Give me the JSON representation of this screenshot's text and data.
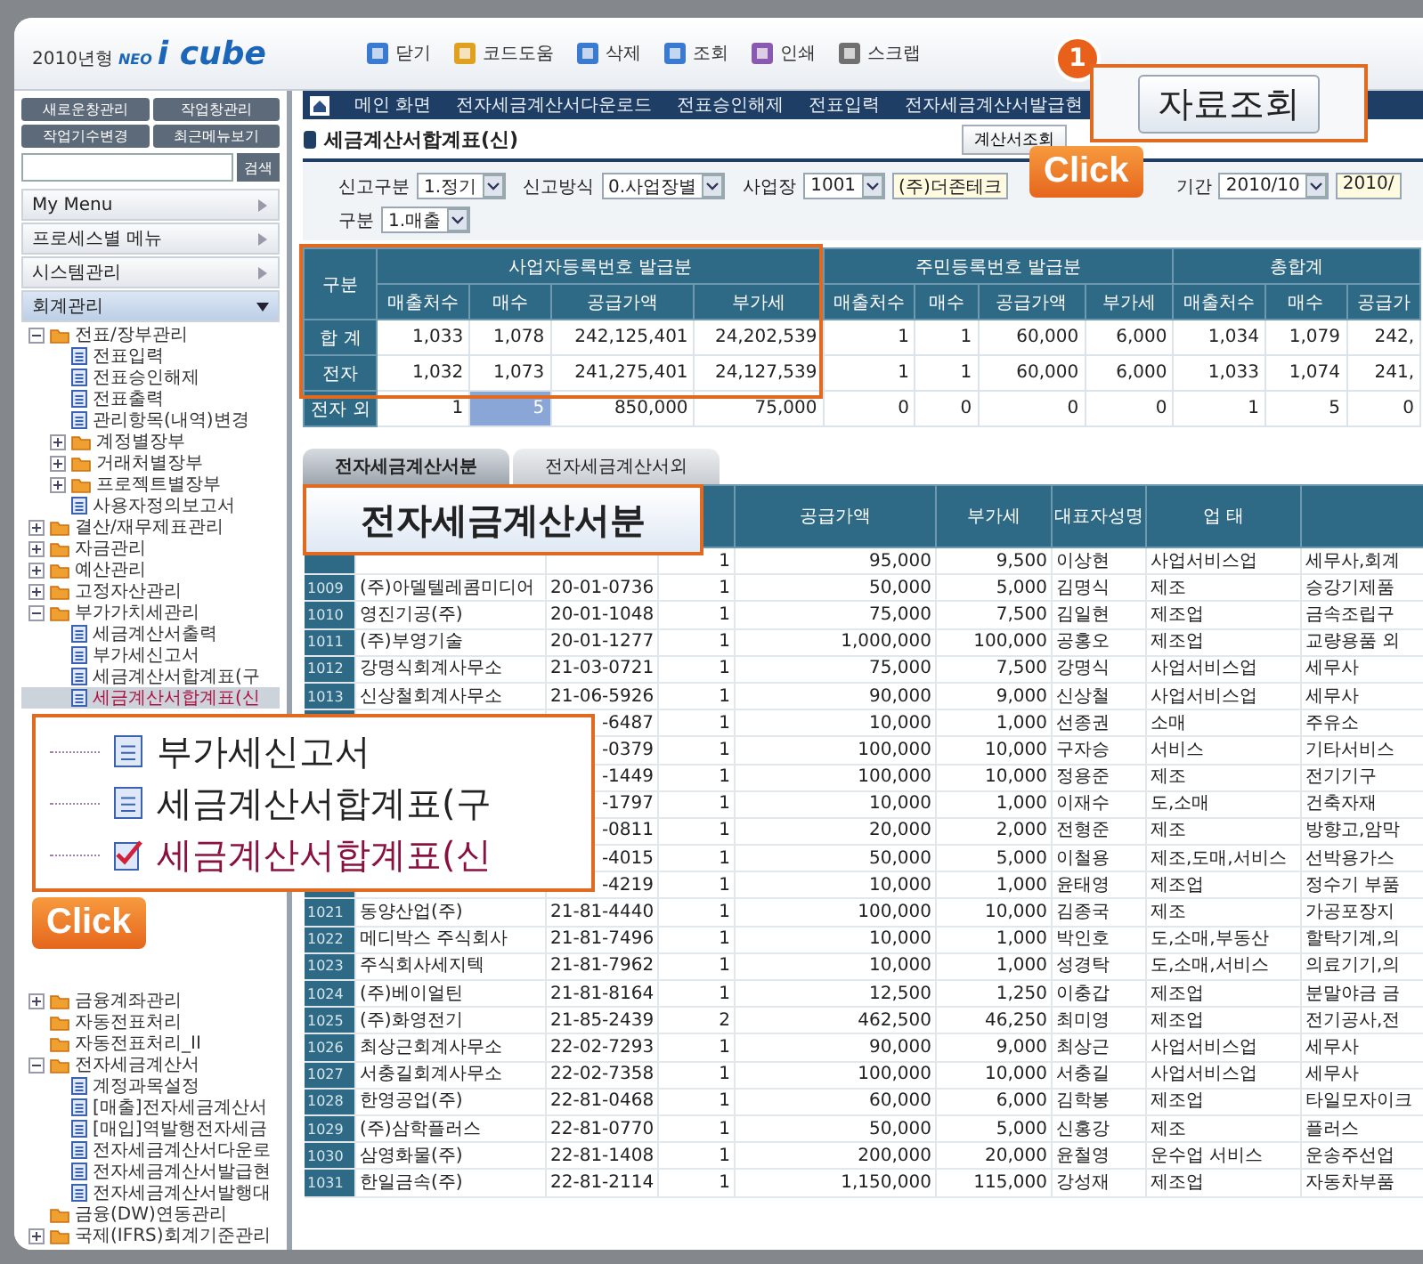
{
  "app": {
    "logo_year": "2010년형",
    "logo_brand": "NEO",
    "logo_product": "i cube"
  },
  "toolbar": [
    {
      "label": "닫기"
    },
    {
      "label": "코드도움"
    },
    {
      "label": "삭제"
    },
    {
      "label": "조회"
    },
    {
      "label": "인쇄"
    },
    {
      "label": "스크랩"
    }
  ],
  "sidebar": {
    "buttons": [
      "새로운창관리",
      "작업창관리",
      "작업기수변경",
      "최근메뉴보기"
    ],
    "search_button": "검색",
    "menus": [
      {
        "label": "My Menu",
        "expanded": false
      },
      {
        "label": "프로세스별 메뉴",
        "expanded": false
      },
      {
        "label": "시스템관리",
        "expanded": false
      },
      {
        "label": "회계관리",
        "expanded": true
      }
    ],
    "tree": [
      {
        "label": "전표/장부관리",
        "kind": "folder",
        "expanded": true,
        "selected": false,
        "children": [
          {
            "label": "전표입력",
            "kind": "page",
            "selected": false
          },
          {
            "label": "전표승인해제",
            "kind": "page",
            "selected": false
          },
          {
            "label": "전표출력",
            "kind": "page",
            "selected": false
          },
          {
            "label": "관리항목(내역)변경",
            "kind": "page",
            "selected": false
          },
          {
            "label": "계정별장부",
            "kind": "folder",
            "expanded": false,
            "selected": false
          },
          {
            "label": "거래처별장부",
            "kind": "folder",
            "expanded": false,
            "selected": false
          },
          {
            "label": "프로젝트별장부",
            "kind": "folder",
            "expanded": false,
            "selected": false
          },
          {
            "label": "사용자정의보고서",
            "kind": "page",
            "selected": false
          }
        ]
      },
      {
        "label": "결산/재무제표관리",
        "kind": "folder",
        "expanded": false,
        "selected": false
      },
      {
        "label": "자금관리",
        "kind": "folder",
        "expanded": false,
        "selected": false
      },
      {
        "label": "예산관리",
        "kind": "folder",
        "expanded": false,
        "selected": false
      },
      {
        "label": "고정자산관리",
        "kind": "folder",
        "expanded": false,
        "selected": false
      },
      {
        "label": "부가가치세관리",
        "kind": "folder",
        "expanded": true,
        "selected": false,
        "children": [
          {
            "label": "세금계산서출력",
            "kind": "page",
            "selected": false
          },
          {
            "label": "부가세신고서",
            "kind": "page",
            "selected": false
          },
          {
            "label": "세금계산서합계표(구",
            "kind": "page",
            "selected": false
          },
          {
            "label": "세금계산서합계표(신",
            "kind": "page",
            "selected": true
          }
        ]
      }
    ],
    "tree_continued": [
      {
        "label": "금융계좌관리",
        "kind": "folder",
        "expanded": false,
        "selected": false
      },
      {
        "label": "자동전표처리",
        "kind": "folder",
        "selected": false
      },
      {
        "label": "자동전표처리_II",
        "kind": "folder",
        "selected": false
      },
      {
        "label": "전자세금계산서",
        "kind": "folder",
        "expanded": true,
        "selected": false,
        "children": [
          {
            "label": "계정과목설정",
            "kind": "page",
            "selected": false
          },
          {
            "label": "[매출]전자세금계산서",
            "kind": "page",
            "selected": false
          },
          {
            "label": "[매입]역발행전자세금",
            "kind": "page",
            "selected": false
          },
          {
            "label": "전자세금계산서다운로",
            "kind": "page",
            "selected": false
          },
          {
            "label": "전자세금계산서발급현",
            "kind": "page",
            "selected": false
          },
          {
            "label": "전자세금계산서발행대",
            "kind": "page",
            "selected": false
          }
        ]
      },
      {
        "label": "금융(DW)연동관리",
        "kind": "folder",
        "selected": false
      },
      {
        "label": "국제(IFRS)회계기준관리",
        "kind": "folder",
        "expanded": false,
        "selected": false
      }
    ]
  },
  "nav_tabs": [
    {
      "label": "메인 화면",
      "selected": false
    },
    {
      "label": "전자세금계산서다운로드",
      "selected": false
    },
    {
      "label": "전표승인해제",
      "selected": false
    },
    {
      "label": "전표입력",
      "selected": false
    },
    {
      "label": "전자세금계산서발급현",
      "selected": false
    }
  ],
  "page": {
    "title": "세금계산서합계표(신)",
    "buttons": [
      "계산서조회"
    ]
  },
  "filters": [
    [
      {
        "label": "신고구분",
        "value": "1.정기"
      },
      {
        "label": "신고방식",
        "value": "0.사업장별"
      },
      {
        "label": "사업장",
        "value": "1001",
        "extra": "(주)더존테크"
      },
      {
        "label": "기간",
        "value": "2010/10",
        "extra": "2010/"
      }
    ],
    [
      {
        "label": "구분",
        "value": "1.매출"
      }
    ]
  ],
  "summary": {
    "corner": "구분",
    "groups": [
      {
        "label": "사업자등록번호 발급분",
        "columns": [
          "매출처수",
          "매수",
          "공급가액",
          "부가세"
        ]
      },
      {
        "label": "주민등록번호 발급분",
        "columns": [
          "매출처수",
          "매수",
          "공급가액",
          "부가세"
        ]
      },
      {
        "label": "총합계",
        "columns": [
          "매출처수",
          "매수",
          "공급가"
        ]
      }
    ],
    "rows": [
      {
        "label": "합 계",
        "cells": [
          {
            "v": "1,033",
            "selected": false
          },
          {
            "v": "1,078",
            "selected": false
          },
          {
            "v": "242,125,401",
            "selected": false
          },
          {
            "v": "24,202,539",
            "selected": false
          },
          {
            "v": "1",
            "selected": false
          },
          {
            "v": "1",
            "selected": false
          },
          {
            "v": "60,000",
            "selected": false
          },
          {
            "v": "6,000",
            "selected": false
          },
          {
            "v": "1,034",
            "selected": false
          },
          {
            "v": "1,079",
            "selected": false
          },
          {
            "v": "242,",
            "selected": false
          }
        ]
      },
      {
        "label": "전자",
        "cells": [
          {
            "v": "1,032",
            "selected": false
          },
          {
            "v": "1,073",
            "selected": false
          },
          {
            "v": "241,275,401",
            "selected": false
          },
          {
            "v": "24,127,539",
            "selected": false
          },
          {
            "v": "1",
            "selected": false
          },
          {
            "v": "1",
            "selected": false
          },
          {
            "v": "60,000",
            "selected": false
          },
          {
            "v": "6,000",
            "selected": false
          },
          {
            "v": "1,033",
            "selected": false
          },
          {
            "v": "1,074",
            "selected": false
          },
          {
            "v": "241,",
            "selected": false
          }
        ]
      },
      {
        "label": "전자 외",
        "cells": [
          {
            "v": "1",
            "selected": false
          },
          {
            "v": "5",
            "selected": true
          },
          {
            "v": "850,000",
            "selected": false
          },
          {
            "v": "75,000",
            "selected": false
          },
          {
            "v": "0",
            "selected": false
          },
          {
            "v": "0",
            "selected": false
          },
          {
            "v": "0",
            "selected": false
          },
          {
            "v": "0",
            "selected": false
          },
          {
            "v": "1",
            "selected": false
          },
          {
            "v": "5",
            "selected": false
          },
          {
            "v": "0",
            "selected": false
          }
        ]
      }
    ]
  },
  "data_tabs": [
    {
      "label": "전자세금계산서분",
      "selected": true
    },
    {
      "label": "전자세금계산서외",
      "selected": false
    }
  ],
  "grid": {
    "columns": [
      "공급가액",
      "부가세",
      "대표자성명",
      "업 태"
    ],
    "rows": [
      {
        "kind": "covered",
        "count": "1",
        "supply": "95,000",
        "tax": "9,500",
        "rep": "이상현",
        "type": "사업서비스업",
        "item": "세무사,회계"
      },
      {
        "kind": "full",
        "code": "1009",
        "company": "(주)아델텔레콤미디어",
        "biz_no": "20-01-0736",
        "count": "1",
        "supply": "50,000",
        "tax": "5,000",
        "rep": "김명식",
        "type": "제조",
        "item": "승강기제품"
      },
      {
        "kind": "full",
        "code": "1010",
        "company": "영진기공(주)",
        "biz_no": "20-01-1048",
        "count": "1",
        "supply": "75,000",
        "tax": "7,500",
        "rep": "김일현",
        "type": "제조업",
        "item": "금속조립구"
      },
      {
        "kind": "full",
        "code": "1011",
        "company": "(주)부영기술",
        "biz_no": "20-01-1277",
        "count": "1",
        "supply": "1,000,000",
        "tax": "100,000",
        "rep": "공홍오",
        "type": "제조업",
        "item": "교량용품 외"
      },
      {
        "kind": "full",
        "code": "1012",
        "company": "강명식회계사무소",
        "biz_no": "21-03-0721",
        "count": "1",
        "supply": "75,000",
        "tax": "7,500",
        "rep": "강명식",
        "type": "사업서비스업",
        "item": "세무사"
      },
      {
        "kind": "full",
        "code": "1013",
        "company": "신상철회계사무소",
        "biz_no": "21-06-5926",
        "count": "1",
        "supply": "90,000",
        "tax": "9,000",
        "rep": "신상철",
        "type": "사업서비스업",
        "item": "세무사"
      },
      {
        "kind": "covered",
        "biz_no": "-6487",
        "count": "1",
        "supply": "10,000",
        "tax": "1,000",
        "rep": "선종권",
        "type": "소매",
        "item": "주유소"
      },
      {
        "kind": "covered",
        "biz_no": "-0379",
        "count": "1",
        "supply": "100,000",
        "tax": "10,000",
        "rep": "구자승",
        "type": "서비스",
        "item": "기타서비스"
      },
      {
        "kind": "covered",
        "biz_no": "-1449",
        "count": "1",
        "supply": "100,000",
        "tax": "10,000",
        "rep": "정용준",
        "type": "제조",
        "item": "전기기구"
      },
      {
        "kind": "covered",
        "biz_no": "-1797",
        "count": "1",
        "supply": "10,000",
        "tax": "1,000",
        "rep": "이재수",
        "type": "도,소매",
        "item": "건축자재"
      },
      {
        "kind": "covered",
        "biz_no": "-0811",
        "count": "1",
        "supply": "20,000",
        "tax": "2,000",
        "rep": "전형준",
        "type": "제조",
        "item": "방향고,암막"
      },
      {
        "kind": "covered",
        "biz_no": "-4015",
        "count": "1",
        "supply": "50,000",
        "tax": "5,000",
        "rep": "이철용",
        "type": "제조,도매,서비스",
        "item": "선박용가스"
      },
      {
        "kind": "covered",
        "biz_no": "-4219",
        "count": "1",
        "supply": "10,000",
        "tax": "1,000",
        "rep": "윤태영",
        "type": "제조업",
        "item": "정수기 부품"
      },
      {
        "kind": "full",
        "code": "1021",
        "company": "동양산업(주)",
        "biz_no": "21-81-4440",
        "count": "1",
        "supply": "100,000",
        "tax": "10,000",
        "rep": "김종국",
        "type": "제조",
        "item": "가공포장지"
      },
      {
        "kind": "full",
        "code": "1022",
        "company": "메디박스 주식회사",
        "biz_no": "21-81-7496",
        "count": "1",
        "supply": "10,000",
        "tax": "1,000",
        "rep": "박인호",
        "type": "도,소매,부동산",
        "item": "할탁기계,의"
      },
      {
        "kind": "full",
        "code": "1023",
        "company": "주식회사세지텍",
        "biz_no": "21-81-7962",
        "count": "1",
        "supply": "10,000",
        "tax": "1,000",
        "rep": "성경탁",
        "type": "도,소매,서비스",
        "item": "의료기기,의"
      },
      {
        "kind": "full",
        "code": "1024",
        "company": "(주)베이얼틴",
        "biz_no": "21-81-8164",
        "count": "1",
        "supply": "12,500",
        "tax": "1,250",
        "rep": "이충갑",
        "type": "제조업",
        "item": "분말야금 금"
      },
      {
        "kind": "full",
        "code": "1025",
        "company": "(주)화영전기",
        "biz_no": "21-85-2439",
        "count": "2",
        "supply": "462,500",
        "tax": "46,250",
        "rep": "최미영",
        "type": "제조업",
        "item": "전기공사,전"
      },
      {
        "kind": "full",
        "code": "1026",
        "company": "최상근회계사무소",
        "biz_no": "22-02-7293",
        "count": "1",
        "supply": "90,000",
        "tax": "9,000",
        "rep": "최상근",
        "type": "사업서비스업",
        "item": "세무사"
      },
      {
        "kind": "full",
        "code": "1027",
        "company": "서충길회계사무소",
        "biz_no": "22-02-7358",
        "count": "1",
        "supply": "100,000",
        "tax": "10,000",
        "rep": "서충길",
        "type": "사업서비스업",
        "item": "세무사"
      },
      {
        "kind": "full",
        "code": "1028",
        "company": "한영공업(주)",
        "biz_no": "22-81-0468",
        "count": "1",
        "supply": "60,000",
        "tax": "6,000",
        "rep": "김학봉",
        "type": "제조업",
        "item": "타일모자이크"
      },
      {
        "kind": "full",
        "code": "1029",
        "company": "(주)삼학플러스",
        "biz_no": "22-81-0770",
        "count": "1",
        "supply": "50,000",
        "tax": "5,000",
        "rep": "신홍강",
        "type": "제조",
        "item": "플러스"
      },
      {
        "kind": "full",
        "code": "1030",
        "company": "삼영화물(주)",
        "biz_no": "22-81-1408",
        "count": "1",
        "supply": "200,000",
        "tax": "20,000",
        "rep": "윤철영",
        "type": "운수업 서비스",
        "item": "운송주선업"
      },
      {
        "kind": "full",
        "code": "1031",
        "company": "한일금속(주)",
        "biz_no": "22-81-2114",
        "count": "1",
        "supply": "1,150,000",
        "tax": "115,000",
        "rep": "강성재",
        "type": "제조업",
        "item": "자동차부품"
      }
    ]
  },
  "callouts": {
    "step_badge": "1",
    "button_callout": "자료조회",
    "click_labels": [
      "Click",
      "Click"
    ],
    "tab_callout": "전자세금계산서분",
    "menu_callout": [
      {
        "label": "부가세신고서",
        "kind": "page",
        "selected": false
      },
      {
        "label": "세금계산서합계표(구",
        "kind": "page",
        "selected": false
      },
      {
        "label": "세금계산서합계표(신",
        "kind": "page",
        "selected": true
      }
    ]
  }
}
